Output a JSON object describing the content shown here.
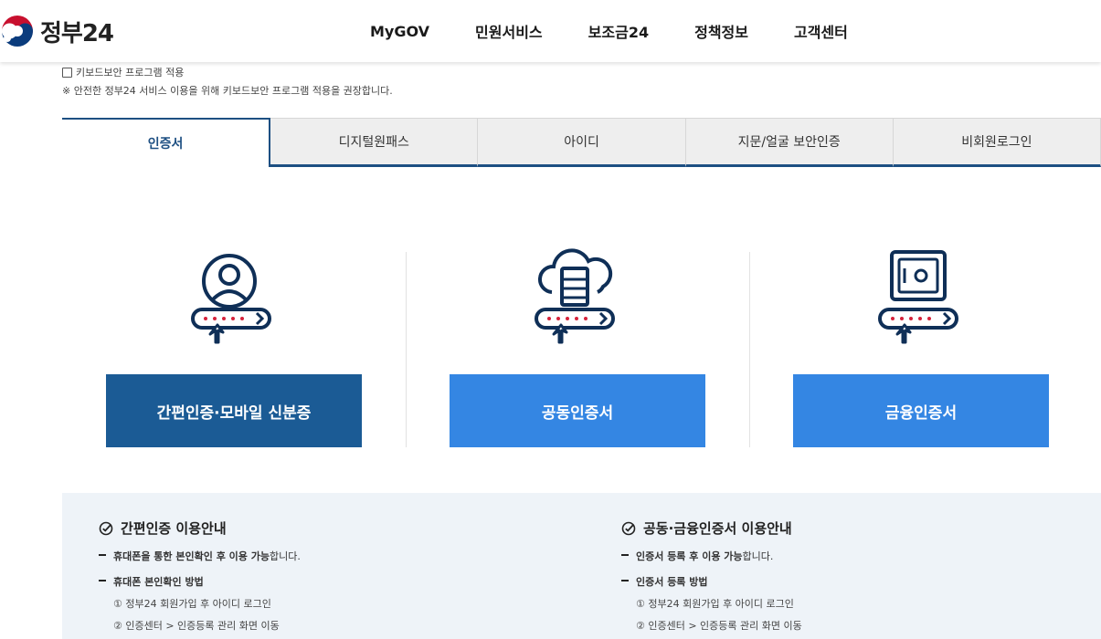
{
  "header": {
    "logo_text": "정부24",
    "nav": [
      "MyGOV",
      "민원서비스",
      "보조금24",
      "정책정보",
      "고객센터"
    ]
  },
  "keyboard": {
    "checkbox_label": "키보드보안 프로그램 적용",
    "note": "※ 안전한 정부24 서비스 이용을 위해 키보드보안 프로그램 적용을 권장합니다."
  },
  "tabs": [
    "인증서",
    "디지털원패스",
    "아이디",
    "지문/얼굴 보안인증",
    "비회원로그인"
  ],
  "cards": [
    {
      "label": "간편인증·모바일 신분증",
      "icon": "person-id-icon"
    },
    {
      "label": "공동인증서",
      "icon": "cloud-server-icon"
    },
    {
      "label": "금융인증서",
      "icon": "safe-icon"
    }
  ],
  "info": {
    "left": {
      "title": "간편인증 이용안내",
      "b1_bold": "휴대폰을 통한 본인확인 후 이용 가능",
      "b1_rest": "합니다.",
      "b2": "휴대폰 본인확인 방법",
      "s1": "① 정부24 회원가입 후 아이디 로그인",
      "s2": "② 인증센터 > 인증등록 관리 화면 이동"
    },
    "right": {
      "title": "공동·금융인증서 이용안내",
      "b1_bold": "인증서 등록 후 이용 가능",
      "b1_rest": "합니다.",
      "b2": "인증서 등록 방법",
      "s1": "① 정부24 회원가입 후 아이디 로그인",
      "s2": "② 인증센터 > 인증등록 관리 화면 이동"
    }
  },
  "colors": {
    "primary_dark": "#1b5b95",
    "primary_light": "#3486e3",
    "tab_border": "#1d4f82",
    "dots": "#d6223a"
  }
}
